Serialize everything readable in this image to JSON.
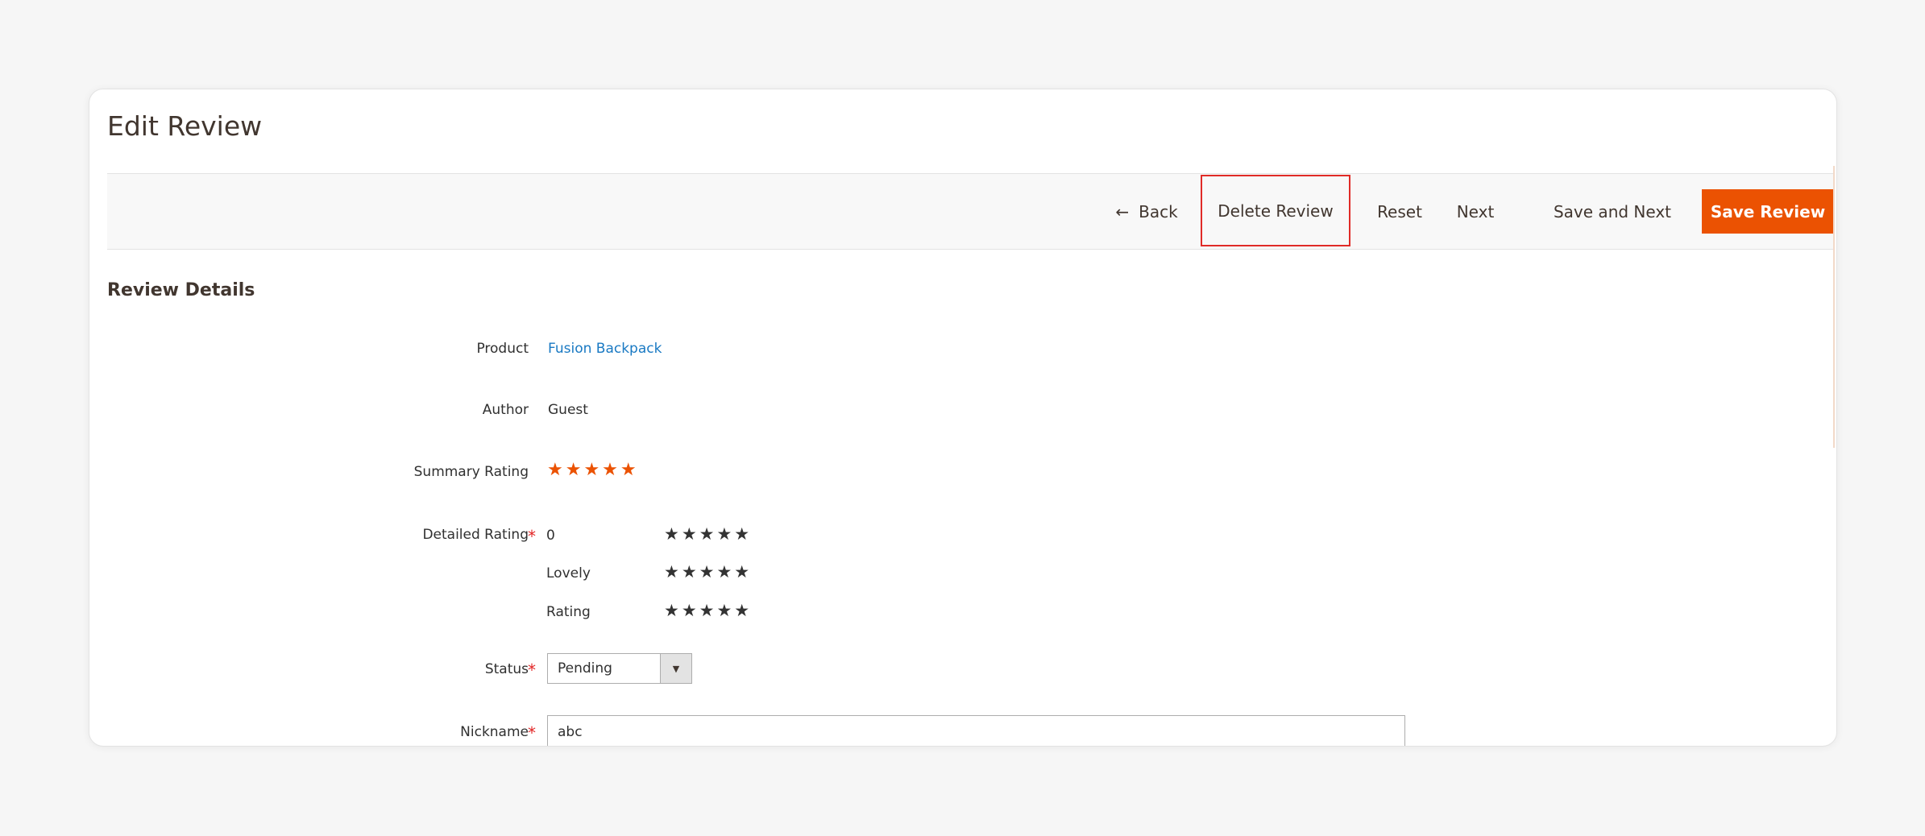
{
  "page": {
    "title": "Edit Review"
  },
  "toolbar": {
    "back_icon": "←",
    "back_label": "Back",
    "delete_label": "Delete Review",
    "reset_label": "Reset",
    "next_label": "Next",
    "save_next_label": "Save and Next",
    "save_label": "Save Review",
    "accent_color": "#eb5202",
    "highlight_color": "#e02b27"
  },
  "section": {
    "title": "Review Details"
  },
  "form": {
    "product": {
      "label": "Product",
      "value": "Fusion Backpack"
    },
    "author": {
      "label": "Author",
      "value": "Guest"
    },
    "summary_rating": {
      "label": "Summary Rating",
      "stars": "★★★★★",
      "rating": 5,
      "max": 5
    },
    "detailed_rating": {
      "label": "Detailed Rating",
      "required": "*",
      "items": [
        {
          "name": "0",
          "stars": "★★★★★"
        },
        {
          "name": "Lovely",
          "stars": "★★★★★"
        },
        {
          "name": "Rating",
          "stars": "★★★★★"
        }
      ]
    },
    "status": {
      "label": "Status",
      "required": "*",
      "value": "Pending",
      "arrow": "▼"
    },
    "nickname": {
      "label": "Nickname",
      "required": "*",
      "value": "abc"
    }
  }
}
